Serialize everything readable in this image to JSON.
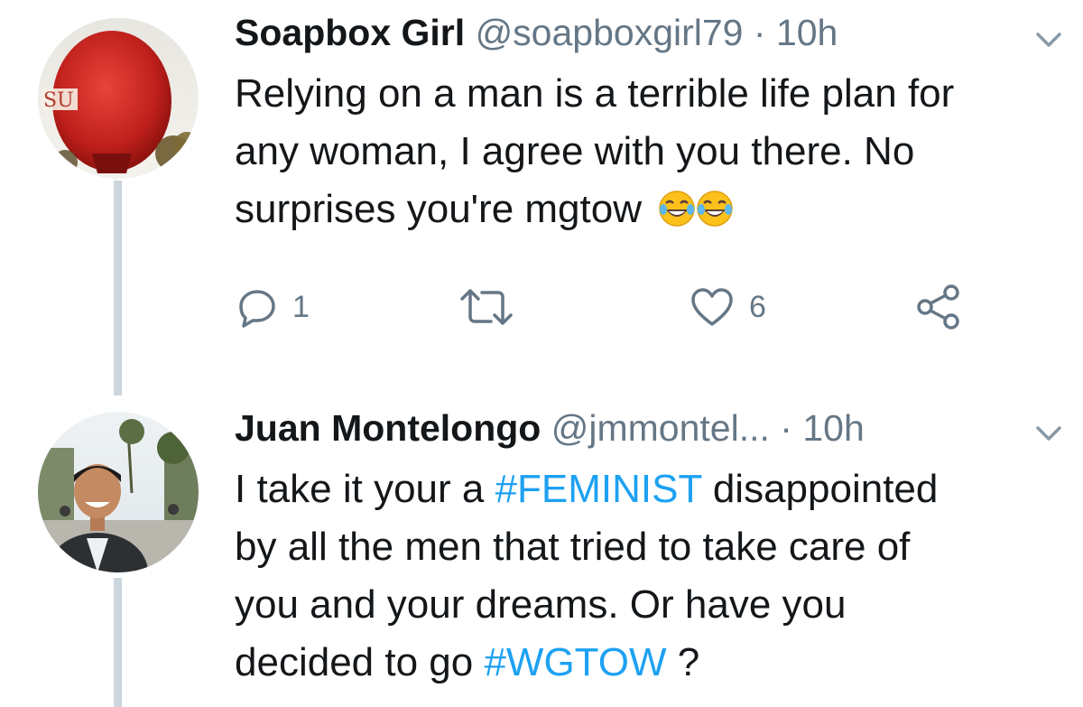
{
  "tweets": [
    {
      "author_name": "Soapbox Girl",
      "handle": "@soapboxgirl79",
      "separator": "·",
      "time": "10h",
      "avatar_text": "SU",
      "text_lines": [
        "Relying on a man is a terrible life plan for",
        "any woman, I agree with you there. No",
        "surprises you're mgtow"
      ],
      "emojis": [
        "face-with-tears-of-joy-icon",
        "face-with-tears-of-joy-icon"
      ],
      "actions": {
        "reply_count": "1",
        "retweet_count": "",
        "like_count": "6"
      }
    },
    {
      "author_name": "Juan Montelongo",
      "handle": "@jmmontel...",
      "separator": "·",
      "time": "10h",
      "text_line1_a": "I take it your a ",
      "text_line1_hashtag": "#FEMINIST",
      "text_line1_b": " disappointed",
      "text_line2": "by all the men that tried to take care of",
      "text_line3": "you and your dreams. Or have you",
      "text_line4_a": "decided to go ",
      "text_line4_hashtag": "#WGTOW",
      "text_line4_b": " ?"
    }
  ],
  "colors": {
    "text": "#14171a",
    "secondary": "#657786",
    "hashtag": "#1da1f2",
    "thread_line": "#ccd6dd"
  }
}
